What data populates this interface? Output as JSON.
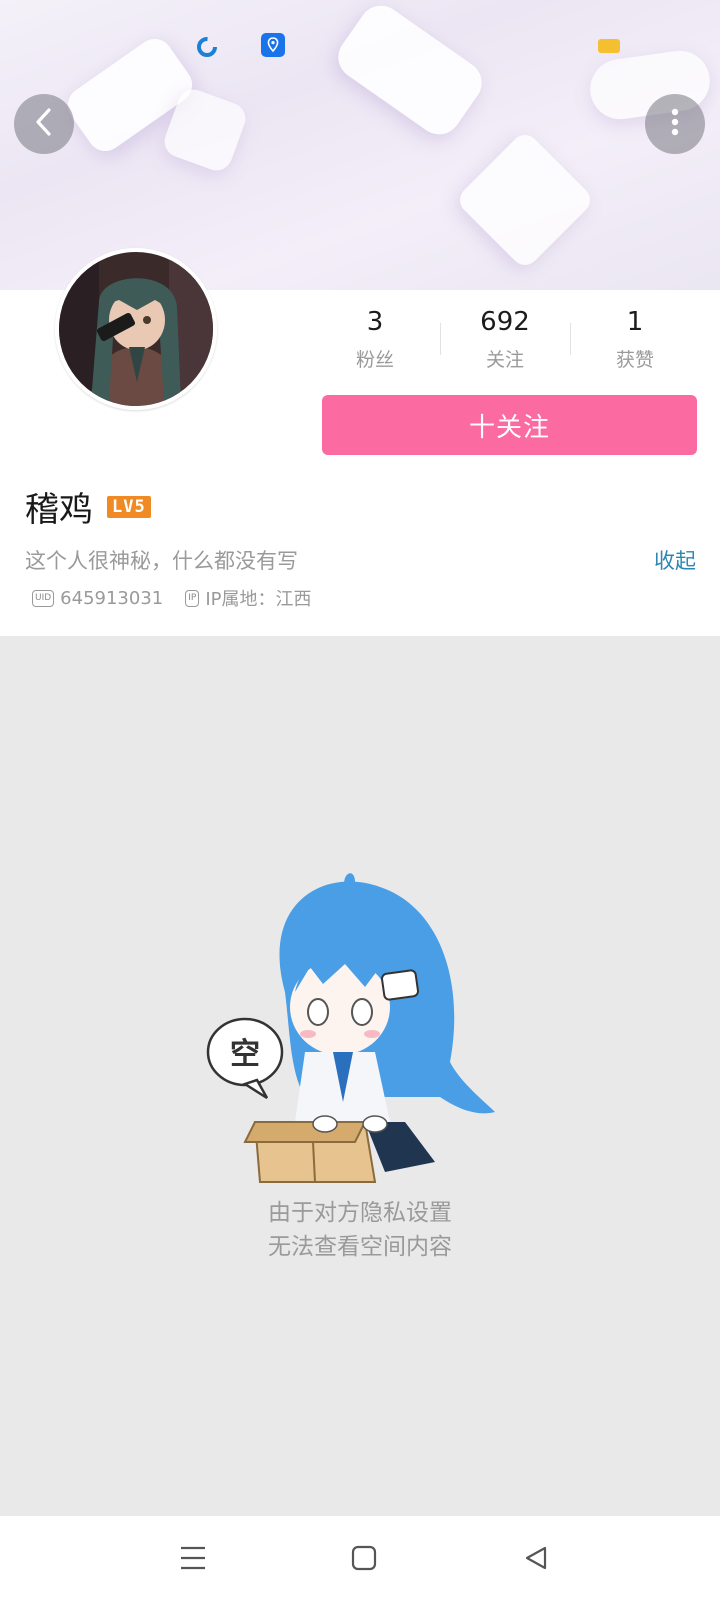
{
  "status_bar": {
    "icons": [
      "loading-ring-icon",
      "location-pin-icon",
      "battery-icon"
    ],
    "colors": {
      "loading": "#1e7fd6",
      "location": "#1a73e8",
      "battery": "#f5c030"
    }
  },
  "header": {
    "back_icon": "chevron-left-icon",
    "more_icon": "more-vertical-icon"
  },
  "profile": {
    "avatar_icon": "avatar",
    "stats": [
      {
        "value": "3",
        "label": "粉丝"
      },
      {
        "value": "692",
        "label": "关注"
      },
      {
        "value": "1",
        "label": "获赞"
      }
    ],
    "follow_button": "十关注",
    "username": "稽鸡",
    "level": "LV5",
    "signature": "这个人很神秘，什么都没有写",
    "collapse_label": "收起",
    "uid_tag": "UID",
    "uid": "645913031",
    "ip_tag": "IP",
    "ip_location": "IP属地：江西"
  },
  "empty_state": {
    "bubble_text": "空",
    "line1": "由于对方隐私设置",
    "line2": "无法查看空间内容"
  },
  "system_nav": {
    "buttons": [
      "menu-icon",
      "home-square-icon",
      "back-triangle-icon"
    ]
  },
  "colors": {
    "accent_pink": "#fb6aa0",
    "link_blue": "#2d87b5",
    "level_orange": "#f08a24",
    "empty_bg": "#e9e9ea"
  }
}
